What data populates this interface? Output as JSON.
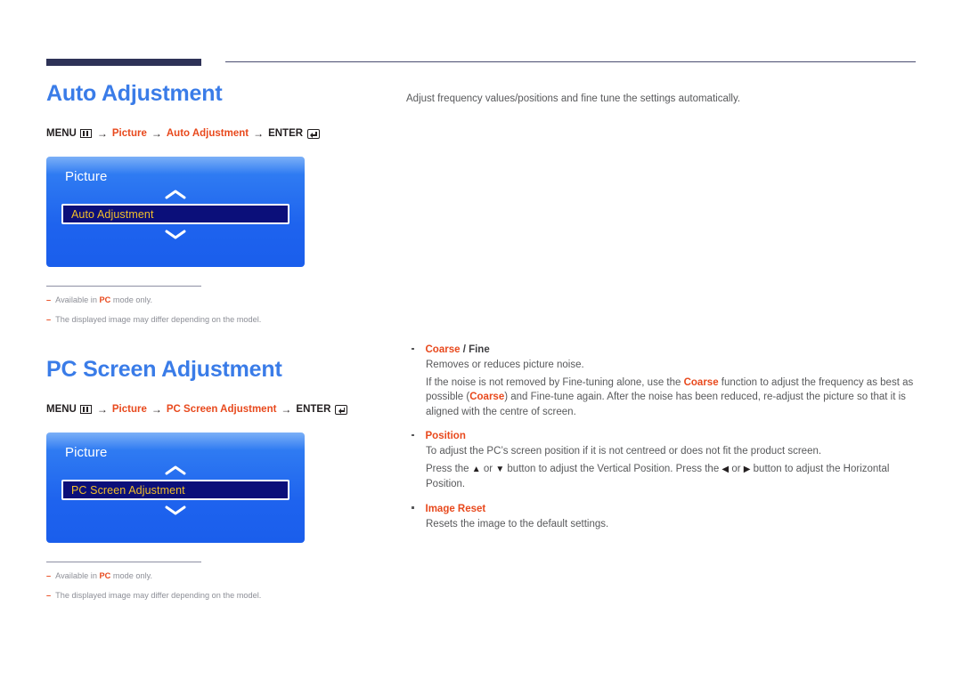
{
  "theme": {
    "heading_blue": "#3a7ce8",
    "accent_orange": "#e8491d",
    "rule_navy": "#2e3257",
    "osd_blue_top": "#7cb0f7",
    "osd_blue_bottom": "#1a5eec",
    "osd_row_navy": "#0b0f7a",
    "osd_row_gold": "#f2bf2a",
    "body_gray": "#58595b",
    "note_gray": "#8d8f97"
  },
  "sections": [
    {
      "title": "Auto Adjustment",
      "menu_path": {
        "menu_label": "MENU",
        "menu_icon": "menu-grid-icon",
        "arrow": "→",
        "steps": [
          "Picture",
          "Auto Adjustment"
        ],
        "enter_label": "ENTER",
        "enter_icon": "enter-key-icon"
      },
      "osd": {
        "title": "Picture",
        "up_icon": "chevron-up-icon",
        "down_icon": "chevron-down-icon",
        "selected_item": "Auto Adjustment"
      },
      "notes": [
        {
          "dash": "–",
          "before": "Available in ",
          "keyword": "PC",
          "after": " mode only."
        },
        {
          "dash": "–",
          "before": "The displayed image may differ depending on the model.",
          "keyword": "",
          "after": ""
        }
      ],
      "intro": "Adjust frequency values/positions and fine tune the settings automatically."
    },
    {
      "title": "PC Screen Adjustment",
      "menu_path": {
        "menu_label": "MENU",
        "menu_icon": "menu-grid-icon",
        "arrow": "→",
        "steps": [
          "Picture",
          "PC Screen Adjustment"
        ],
        "enter_label": "ENTER",
        "enter_icon": "enter-key-icon"
      },
      "osd": {
        "title": "Picture",
        "up_icon": "chevron-up-icon",
        "down_icon": "chevron-down-icon",
        "selected_item": "PC Screen Adjustment"
      },
      "notes": [
        {
          "dash": "–",
          "before": "Available in ",
          "keyword": "PC",
          "after": " mode only."
        },
        {
          "dash": "–",
          "before": "The displayed image may differ depending on the model.",
          "keyword": "",
          "after": ""
        }
      ]
    }
  ],
  "bullets": [
    {
      "title_accent": "Coarse",
      "title_rest": " / Fine",
      "lines": [
        {
          "parts": [
            {
              "t": "Removes or reduces picture noise.",
              "s": "n"
            }
          ]
        },
        {
          "parts": [
            {
              "t": "If the noise is not removed by Fine-tuning alone, use the ",
              "s": "n"
            },
            {
              "t": "Coarse",
              "s": "kw"
            },
            {
              "t": " function to adjust the frequency as best as possible (",
              "s": "n"
            },
            {
              "t": "Coarse",
              "s": "kw"
            },
            {
              "t": ") and Fine-tune again. After the noise has been reduced, re-adjust the picture so that it is aligned with the centre of screen.",
              "s": "n"
            }
          ]
        }
      ]
    },
    {
      "title_accent": "Position",
      "title_rest": "",
      "lines": [
        {
          "parts": [
            {
              "t": "To adjust the PC’s screen position if it is not centreed or does not fit the product screen.",
              "s": "n"
            }
          ]
        },
        {
          "parts": [
            {
              "t": "Press the ",
              "s": "n"
            },
            {
              "t": "▲",
              "s": "g"
            },
            {
              "t": " or ",
              "s": "n"
            },
            {
              "t": "▼",
              "s": "g"
            },
            {
              "t": " button to adjust the Vertical Position. Press the ",
              "s": "n"
            },
            {
              "t": "◀",
              "s": "g"
            },
            {
              "t": " or ",
              "s": "n"
            },
            {
              "t": "▶",
              "s": "g"
            },
            {
              "t": " button to adjust the Horizontal Position.",
              "s": "n"
            }
          ]
        }
      ]
    },
    {
      "title_accent": "Image Reset",
      "title_rest": "",
      "lines": [
        {
          "parts": [
            {
              "t": "Resets the image to the default settings.",
              "s": "n"
            }
          ]
        }
      ]
    }
  ]
}
